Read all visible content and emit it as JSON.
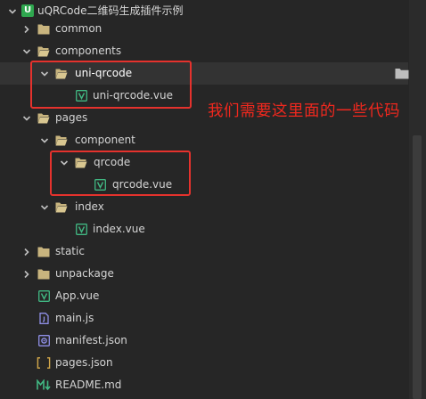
{
  "explorer": {
    "root": {
      "label": "uQRCode二维码生成插件示例",
      "badge": "U"
    },
    "items": [
      {
        "label": "common"
      },
      {
        "label": "components"
      },
      {
        "label": "uni-qrcode"
      },
      {
        "label": "uni-qrcode.vue"
      },
      {
        "label": "pages"
      },
      {
        "label": "component"
      },
      {
        "label": "qrcode"
      },
      {
        "label": "qrcode.vue"
      },
      {
        "label": "index"
      },
      {
        "label": "index.vue"
      },
      {
        "label": "static"
      },
      {
        "label": "unpackage"
      },
      {
        "label": "App.vue"
      },
      {
        "label": "main.js"
      },
      {
        "label": "manifest.json"
      },
      {
        "label": "pages.json"
      },
      {
        "label": "README.md"
      }
    ]
  },
  "annotation": {
    "text": "我们需要这里面的一些代码",
    "color": "#e5322d"
  },
  "colors": {
    "background": "#262626",
    "folder": "#c8b47e",
    "vue": "#41b883",
    "js": "#8f8fe6",
    "json": "#d4a84a",
    "markdown": "#41b883",
    "selected_row": "#333333"
  }
}
